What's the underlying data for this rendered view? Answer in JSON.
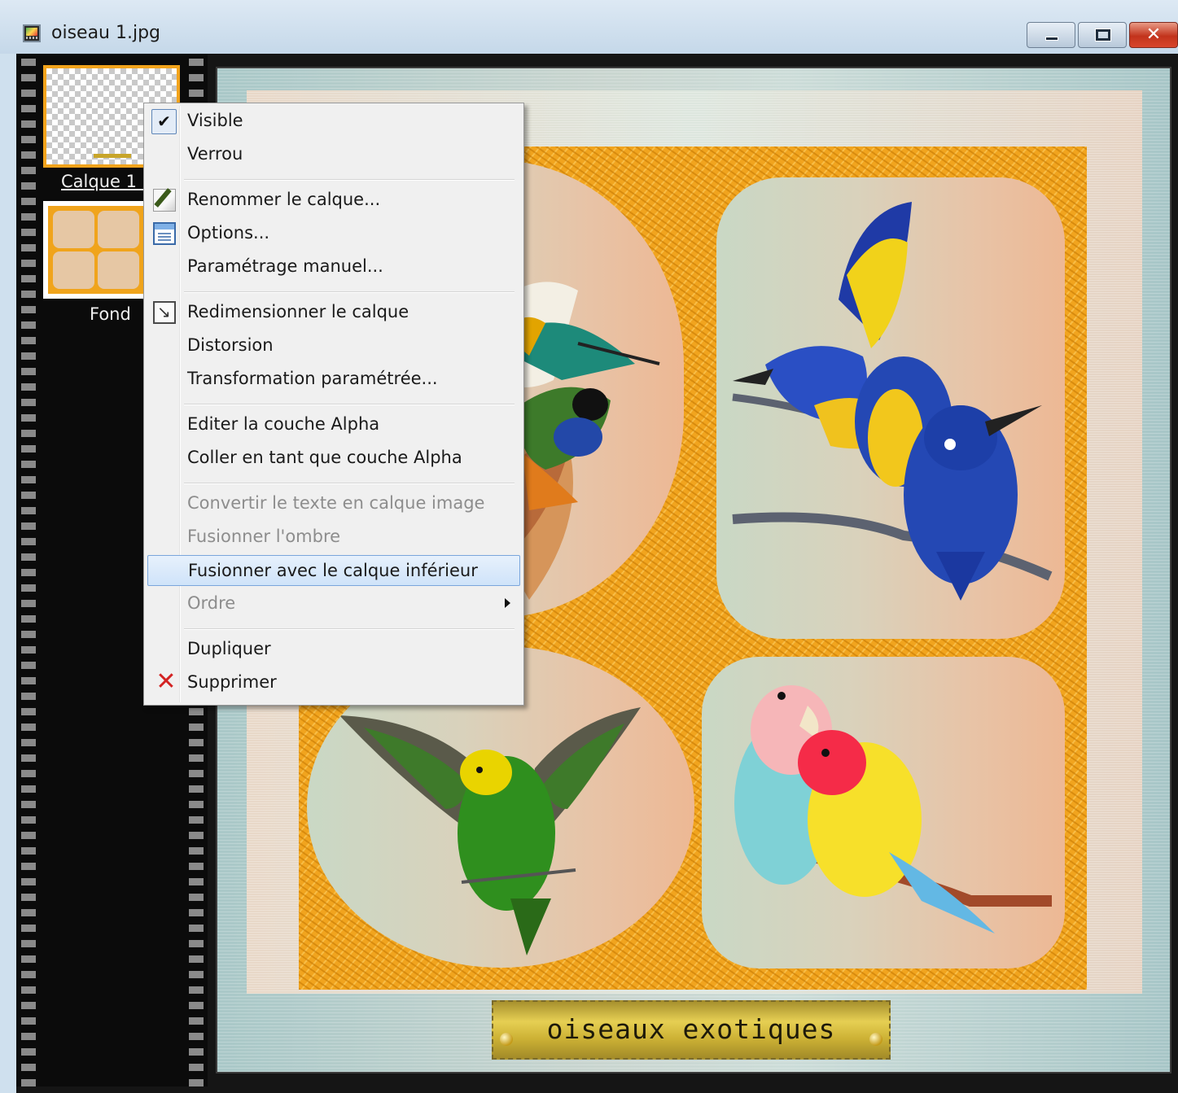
{
  "window": {
    "title": "oiseau 1.jpg",
    "controls": [
      "minimize-icon",
      "maximize-icon",
      "close-icon"
    ]
  },
  "layers": [
    {
      "name": "Calque 1 (",
      "selected": true,
      "thumbnail": "transparent-checkerboard"
    },
    {
      "name": "Fond",
      "selected": false,
      "thumbnail": "bird-collage"
    }
  ],
  "canvas": {
    "plaque_text": "oiseaux exotiques",
    "frames": [
      "birds-on-nest",
      "kingfishers",
      "budgerigar",
      "lovebirds"
    ]
  },
  "context_menu": {
    "visible": {
      "label": "Visible",
      "checked": true,
      "icon": "check-icon"
    },
    "lock": {
      "label": "Verrou"
    },
    "rename": {
      "label": "Renommer le calque...",
      "icon": "rename-icon"
    },
    "options": {
      "label": "Options...",
      "icon": "options-icon"
    },
    "manual_settings": {
      "label": "Paramétrage manuel..."
    },
    "resize": {
      "label": "Redimensionner le calque",
      "icon": "resize-icon"
    },
    "distortion": {
      "label": "Distorsion"
    },
    "param_transform": {
      "label": "Transformation paramétrée..."
    },
    "edit_alpha": {
      "label": "Editer la couche Alpha"
    },
    "paste_alpha": {
      "label": "Coller en tant que couche Alpha"
    },
    "convert_text": {
      "label": "Convertir le texte en calque image",
      "disabled": true
    },
    "merge_shadow": {
      "label": "Fusionner l'ombre",
      "disabled": true
    },
    "merge_down": {
      "label": "Fusionner avec le calque inférieur",
      "highlighted": true
    },
    "order": {
      "label": "Ordre",
      "disabled": true,
      "has_submenu": true
    },
    "duplicate": {
      "label": "Dupliquer"
    },
    "delete": {
      "label": "Supprimer",
      "icon": "delete-icon"
    }
  },
  "colors": {
    "accent_orange": "#f1a41e",
    "menu_highlight": "#cfe3f9",
    "close_button": "#c2331c",
    "plaque_gold": "#d9c146"
  }
}
